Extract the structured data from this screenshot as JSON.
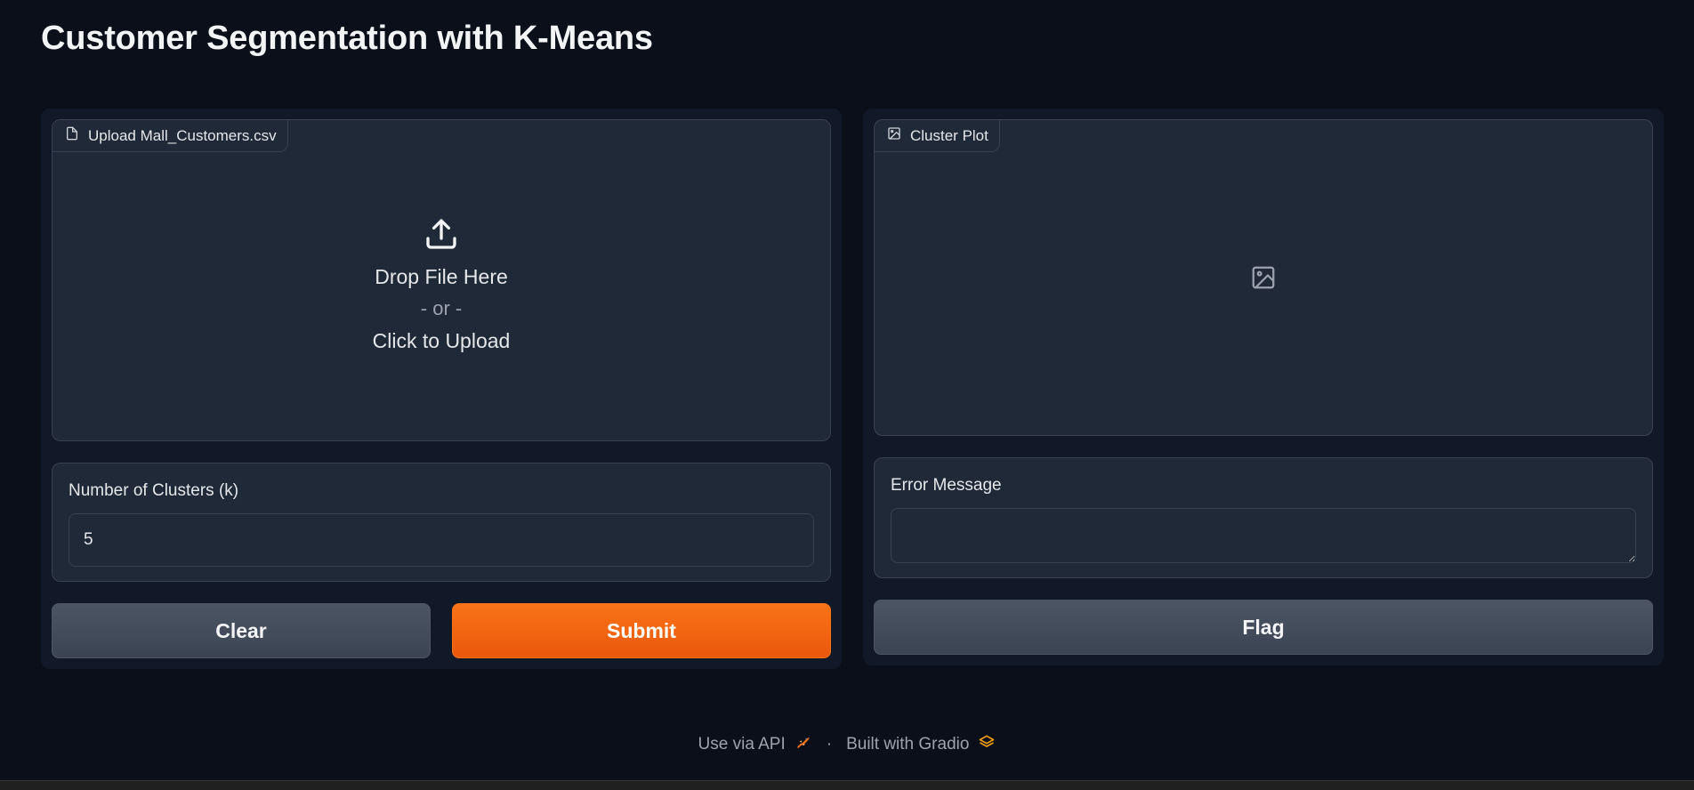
{
  "page": {
    "title": "Customer Segmentation with K-Means"
  },
  "upload": {
    "label": "Upload Mall_Customers.csv",
    "drop_text": "Drop File Here",
    "or_text": "- or -",
    "click_text": "Click to Upload"
  },
  "clusters": {
    "label": "Number of Clusters (k)",
    "value": "5"
  },
  "buttons": {
    "clear": "Clear",
    "submit": "Submit",
    "flag": "Flag"
  },
  "plot": {
    "label": "Cluster Plot"
  },
  "error": {
    "label": "Error Message",
    "value": ""
  },
  "footer": {
    "api": "Use via API",
    "separator": "·",
    "built_with": "Built with Gradio"
  },
  "colors": {
    "accent": "#f97316",
    "background": "#0b0f19",
    "panel": "#111827",
    "block": "#1f2937"
  }
}
